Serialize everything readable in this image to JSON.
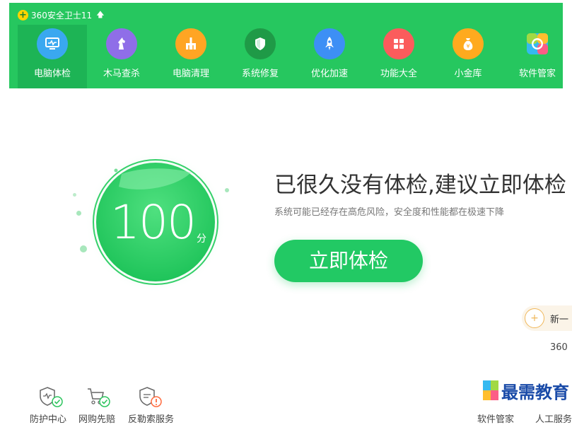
{
  "app": {
    "title": "360安全卫士11"
  },
  "tabs": [
    {
      "label": "电脑体检",
      "icon": "monitor-pulse-icon",
      "color": "#3aa8f0",
      "active": true
    },
    {
      "label": "木马查杀",
      "icon": "horse-icon",
      "color": "#8f6ee8"
    },
    {
      "label": "电脑清理",
      "icon": "broom-icon",
      "color": "#ffa523"
    },
    {
      "label": "系统修复",
      "icon": "shield-icon",
      "color": "#1f9a47"
    },
    {
      "label": "优化加速",
      "icon": "rocket-icon",
      "color": "#3d8ff5"
    },
    {
      "label": "功能大全",
      "icon": "grid-icon",
      "color": "#fb5c5c"
    },
    {
      "label": "小金库",
      "icon": "money-bag-icon",
      "color": "#ffaa1e"
    },
    {
      "label": "软件管家",
      "icon": "software-manager-icon",
      "color": "#35b9f0"
    }
  ],
  "score": {
    "value": "100",
    "unit": "分"
  },
  "main": {
    "headline": "已很久没有体检,建议立即体检",
    "subline": "系统可能已经存在高危风险，安全度和性能都在极速下降",
    "button": "立即体检"
  },
  "side": {
    "new_text": "新一",
    "version": "360"
  },
  "bottom": [
    {
      "label": "防护中心",
      "icon": "shield-check-icon"
    },
    {
      "label": "网购先赔",
      "icon": "cart-check-icon"
    },
    {
      "label": "反勒索服务",
      "icon": "shield-alert-icon"
    },
    {
      "label": "软件管家",
      "icon": "app-icon"
    },
    {
      "label": "人工服务",
      "icon": "support-icon"
    }
  ],
  "watermark": {
    "text": "最需教育"
  }
}
